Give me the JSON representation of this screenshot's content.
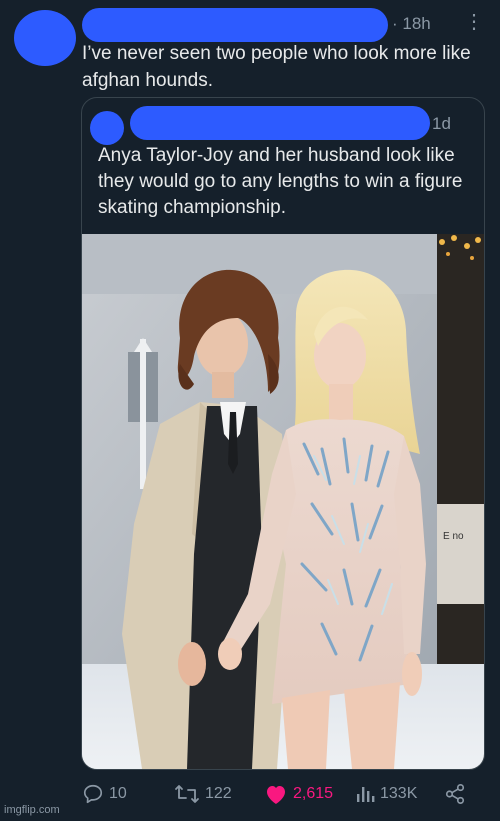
{
  "tweet": {
    "time": "18h",
    "more_icon": "more-vertical-icon",
    "text": "I’ve never seen two people who look more like afghan hounds."
  },
  "quoted_tweet": {
    "time": "1d",
    "text": "Anya Taylor-Joy and her husband look like they would go to any lengths to win a figure skating championship.",
    "image": {
      "backdrop_text": "E no"
    }
  },
  "actions": {
    "reply": {
      "icon": "reply-icon",
      "count": "10"
    },
    "retweet": {
      "icon": "retweet-icon",
      "count": "122"
    },
    "like": {
      "icon": "heart-icon",
      "count": "2,615",
      "color": "#f91880"
    },
    "views": {
      "icon": "views-icon",
      "count": "133K"
    },
    "share": {
      "icon": "share-icon"
    }
  },
  "watermark": "imgflip.com",
  "colors": {
    "background": "#15202b",
    "redaction": "#2d5bff",
    "secondary_text": "#8b98a5"
  }
}
